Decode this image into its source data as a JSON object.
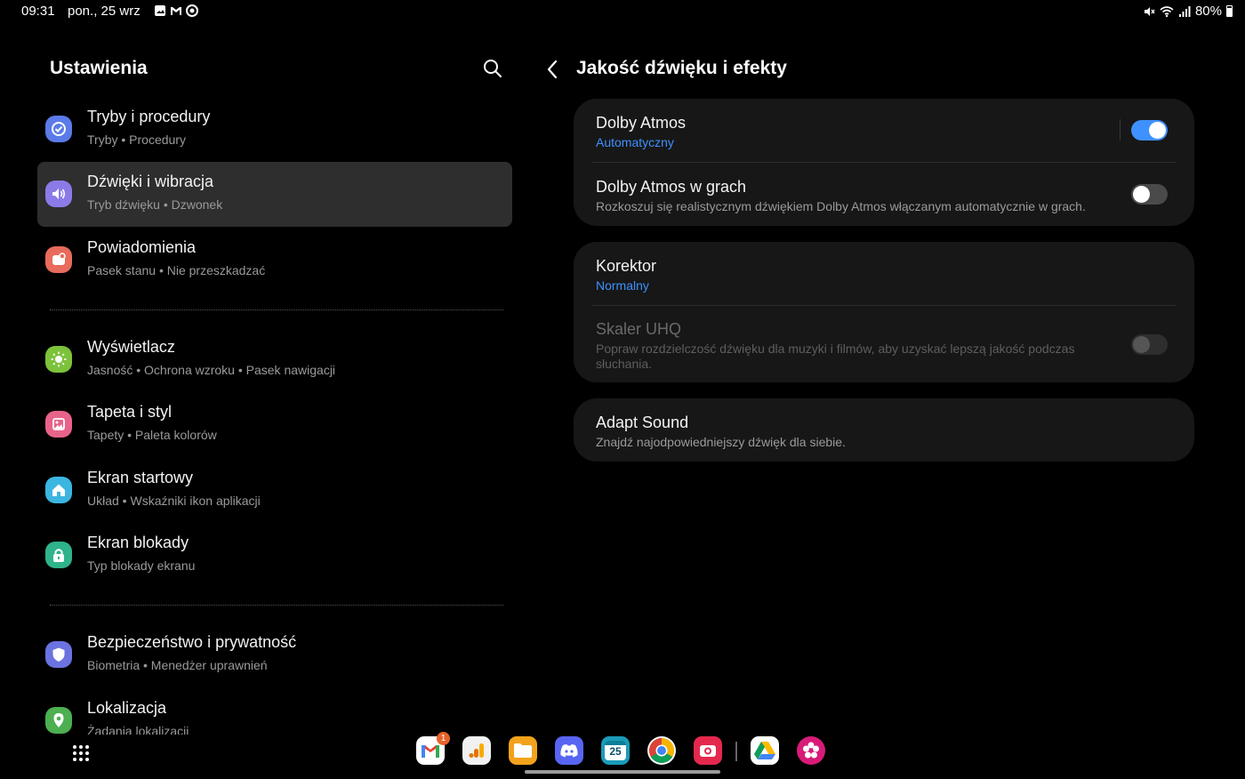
{
  "status_bar": {
    "time": "09:31",
    "date": "pon., 25 wrz",
    "battery": "80%"
  },
  "left_panel": {
    "title": "Ustawienia",
    "items": [
      {
        "title": "Tryby i procedury",
        "subtitle": "Tryby  •  Procedury",
        "icon": "modes-icon",
        "color": "#5b7be8"
      },
      {
        "title": "Dźwięki i wibracja",
        "subtitle": "Tryb dźwięku  •  Dzwonek",
        "icon": "sound-icon",
        "color": "#8b7be8"
      },
      {
        "title": "Powiadomienia",
        "subtitle": "Pasek stanu  •  Nie przeszkadzać",
        "icon": "notifications-icon",
        "color": "#e86b5b"
      },
      {
        "title": "Wyświetlacz",
        "subtitle": "Jasność  •  Ochrona wzroku  •  Pasek nawigacji",
        "icon": "display-icon",
        "color": "#7cc23b"
      },
      {
        "title": "Tapeta i styl",
        "subtitle": "Tapety  •  Paleta kolorów",
        "icon": "wallpaper-icon",
        "color": "#e8638a"
      },
      {
        "title": "Ekran startowy",
        "subtitle": "Układ  •  Wskaźniki ikon aplikacji",
        "icon": "home-icon",
        "color": "#3bb6e0"
      },
      {
        "title": "Ekran blokady",
        "subtitle": "Typ blokady ekranu",
        "icon": "lock-icon",
        "color": "#2fb38a"
      },
      {
        "title": "Bezpieczeństwo i prywatność",
        "subtitle": "Biometria  •  Menedżer uprawnień",
        "icon": "shield-icon",
        "color": "#6b73e0"
      },
      {
        "title": "Lokalizacja",
        "subtitle": "Żądania lokalizacji",
        "icon": "location-icon",
        "color": "#4caf50"
      }
    ]
  },
  "right_panel": {
    "title": "Jakość dźwięku i efekty",
    "card1": {
      "dolby_title": "Dolby Atmos",
      "dolby_sub": "Automatyczny",
      "dolby_enabled": true,
      "games_title": "Dolby Atmos w grach",
      "games_sub": "Rozkoszuj się realistycznym dźwiękiem Dolby Atmos włączanym automatycznie w grach.",
      "games_enabled": false
    },
    "card2": {
      "eq_title": "Korektor",
      "eq_sub": "Normalny",
      "uhq_title": "Skaler UHQ",
      "uhq_sub": "Popraw rozdzielczość dźwięku dla muzyki i filmów, aby uzyskać lepszą jakość podczas słuchania.",
      "uhq_enabled": false
    },
    "card3": {
      "adapt_title": "Adapt Sound",
      "adapt_sub": "Znajdź najodpowiedniejszy dźwięk dla siebie."
    }
  },
  "dock": {
    "gmail_badge": "1",
    "calendar_day": "25",
    "apps": [
      "gmail-icon",
      "analytics-icon",
      "files-icon",
      "discord-icon",
      "calendar-icon",
      "chrome-icon",
      "screen-recorder-icon",
      "drive-icon",
      "flower-app-icon"
    ]
  }
}
